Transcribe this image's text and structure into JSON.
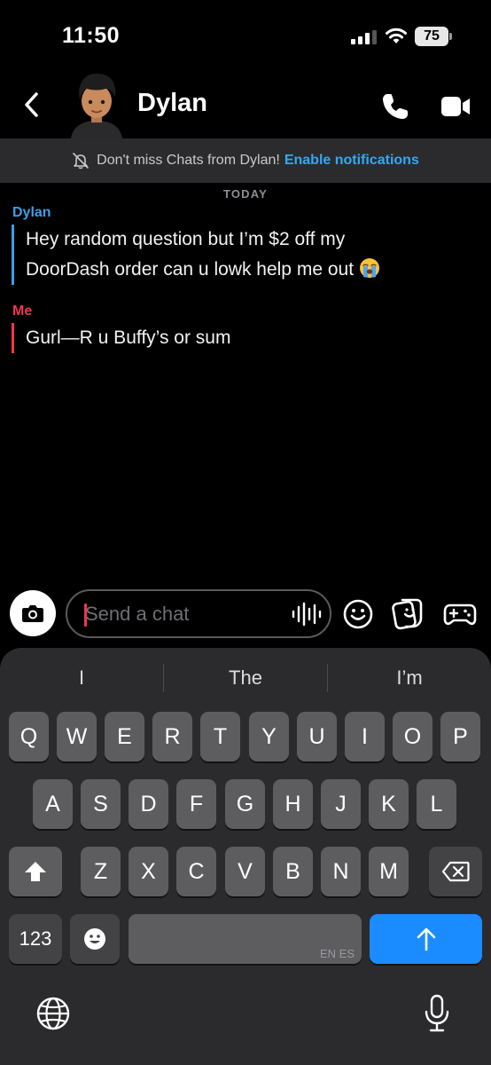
{
  "status_bar": {
    "time": "11:50",
    "battery": "75",
    "signal_icon": "cellular-signal-icon",
    "wifi_icon": "wifi-icon"
  },
  "header": {
    "contact_name": "Dylan",
    "back_icon": "chevron-left-icon",
    "call_icon": "phone-icon",
    "video_icon": "video-camera-icon"
  },
  "banner": {
    "text": "Don't miss Chats from Dylan!",
    "link": "Enable notifications",
    "icon": "bell-off-icon"
  },
  "conversation": {
    "date_label": "TODAY",
    "messages": [
      {
        "sender": "Dylan",
        "line1": "Hey random question but I’m $2 off my",
        "line2": "DoorDash order can u lowk help me out",
        "emoji": "loudly-crying-face"
      },
      {
        "sender": "Me",
        "text": "Gurl—R u Buffy’s or sum"
      }
    ]
  },
  "input_bar": {
    "placeholder": "Send a chat",
    "camera_icon": "camera-icon",
    "voice_icon": "voice-waveform-icon",
    "emoji_icon": "smiley-icon",
    "sticker_icon": "sticker-icon",
    "game_icon": "game-controller-icon"
  },
  "keyboard": {
    "suggestions": [
      "I",
      "The",
      "I’m"
    ],
    "row1": [
      "Q",
      "W",
      "E",
      "R",
      "T",
      "Y",
      "U",
      "I",
      "O",
      "P"
    ],
    "row2": [
      "A",
      "S",
      "D",
      "F",
      "G",
      "H",
      "J",
      "K",
      "L"
    ],
    "row3": [
      "Z",
      "X",
      "C",
      "V",
      "B",
      "N",
      "M"
    ],
    "numbers_key": "123",
    "space_language": "EN ES",
    "shift_icon": "shift-arrow-icon",
    "delete_icon": "backspace-icon",
    "emoji_key_icon": "emoji-icon",
    "send_icon": "arrow-up-icon",
    "globe_icon": "globe-icon",
    "dictation_icon": "microphone-icon"
  },
  "colors": {
    "accent_blue": "#3aa0e8",
    "accent_red": "#f0364e",
    "link_blue": "#35a8f0",
    "send_key_blue": "#1a8cff"
  }
}
